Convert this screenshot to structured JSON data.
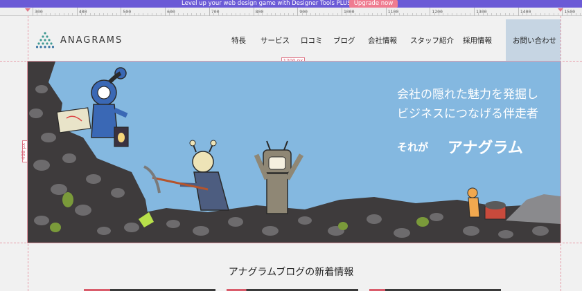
{
  "promo": {
    "text": "Level up your web design game with Designer Tools PLUS",
    "button": "Upgrade now",
    "bg_color": "#6b5ad6",
    "button_color": "#ef7c90"
  },
  "ruler": {
    "labels": [
      "300",
      "400",
      "500",
      "600",
      "700",
      "800",
      "900",
      "1000",
      "1100",
      "1200",
      "1300",
      "1400",
      "1500"
    ]
  },
  "header": {
    "logo_text": "ANAGRAMS",
    "nav": [
      "特長",
      "サービス",
      "口コミ",
      "ブログ",
      "会社情報",
      "スタッフ紹介",
      "採用情報"
    ],
    "contact": "お問い合わせ",
    "contact_bg": "#c6d5e3"
  },
  "measure": {
    "width_label": "1200 px",
    "height_label": "408 px"
  },
  "hero": {
    "line1": "会社の隠れた魅力を発掘し",
    "line2": "ビジネスにつなげる伴走者",
    "line3_prefix": "それが",
    "line3_brand": "アナグラム",
    "sky_color": "#84b8e0"
  },
  "blog": {
    "section_title": "アナグラムブログの新着情報"
  }
}
